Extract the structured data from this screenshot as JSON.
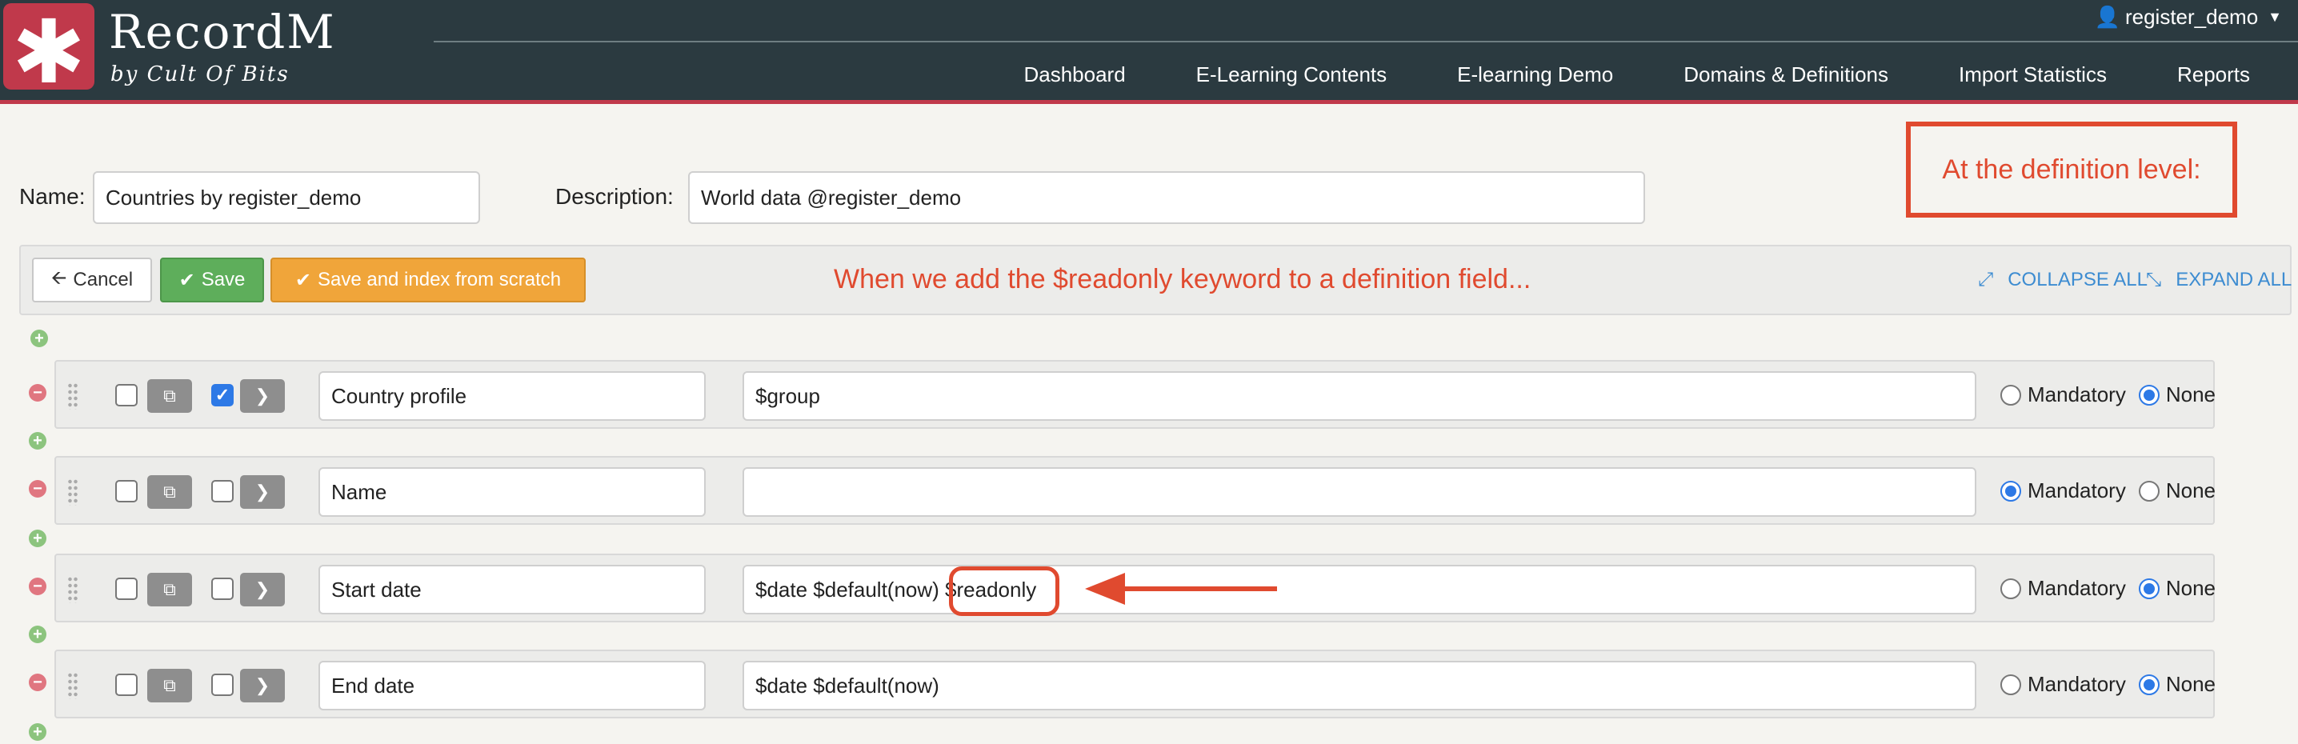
{
  "app": {
    "name": "RecordM",
    "tagline": "by Cult Of Bits",
    "logo_glyph": "✱",
    "user": "register_demo"
  },
  "nav": [
    "Dashboard",
    "E-Learning Contents",
    "E-learning Demo",
    "Domains & Definitions",
    "Import Statistics",
    "Reports"
  ],
  "form": {
    "name_label": "Name:",
    "name_value": "Countries by register_demo",
    "description_label": "Description:",
    "description_value": "World data @register_demo"
  },
  "annotations": {
    "definition_level": "At the definition level:",
    "readonly_note": "When we add the $readonly keyword to a definition field..."
  },
  "toolbar": {
    "cancel": "Cancel",
    "save": "Save",
    "save_index": "Save and index from scratch",
    "collapse_all": "COLLAPSE ALL",
    "expand_all": "EXPAND ALL"
  },
  "radio_labels": {
    "mandatory": "Mandatory",
    "none": "None"
  },
  "fields": [
    {
      "name": "Country profile",
      "description": "$group",
      "selected": true,
      "mandatory": false
    },
    {
      "name": "Name",
      "description": "",
      "selected": false,
      "mandatory": true
    },
    {
      "name": "Start date",
      "description": "$date $default(now) $readonly",
      "selected": false,
      "mandatory": false
    },
    {
      "name": "End date",
      "description": "$date $default(now)",
      "selected": false,
      "mandatory": false
    }
  ],
  "colors": {
    "header_bg": "#2b3a40",
    "brand_red": "#c0394b",
    "annotation_red": "#e04a2f",
    "save_green": "#5eae5b",
    "index_orange": "#f0a53a",
    "link_blue": "#3d8cd1"
  }
}
